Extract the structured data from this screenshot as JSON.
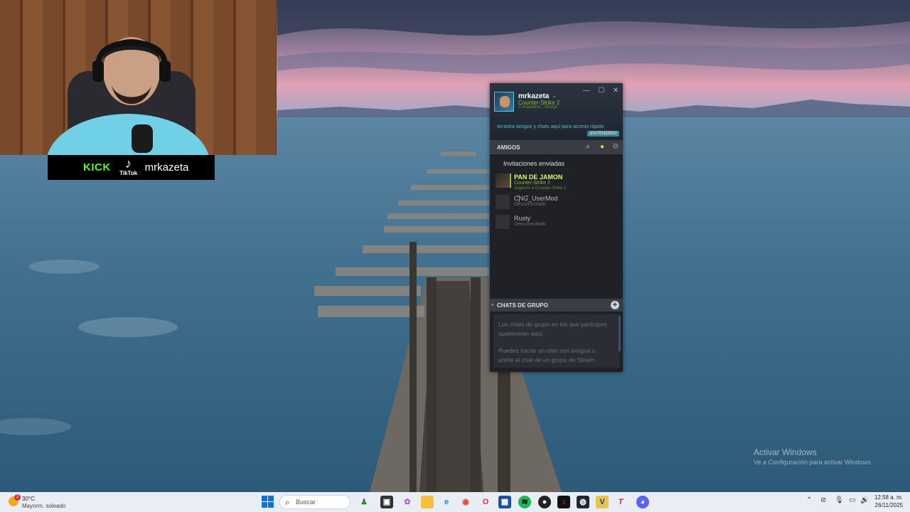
{
  "webcam": {
    "kick_label": "KICK",
    "tiktok_label": "TikTok",
    "channel_name": "mrkazeta"
  },
  "steam": {
    "user": {
      "name": "mrkazeta",
      "game": "Counter-Strike 2",
      "status": "Competitivo - Mirage"
    },
    "window_controls": {
      "minimize": "—",
      "maximize": "☐",
      "close": "✕"
    },
    "tip_text": "Arrastra amigos y chats aquí para acceso rápido",
    "got_it_label": "¡ENTENDIDO!",
    "friends_header": "AMIGOS",
    "sent_invites_label": "Invitaciones enviadas",
    "friends": [
      {
        "name": "PAN DE JAMON",
        "sub": "Counter-Strike 2",
        "sub2": "Jugando a Counter-Strike 2"
      },
      {
        "name": "ƇƝƓ_UserMod",
        "sub": "Desconectado"
      },
      {
        "name": "Rusty",
        "sub": "Desconectado"
      }
    ],
    "group_chats_header": "CHATS DE GRUPO",
    "group_chats_text1": "Los chats de grupo en los que participes aparecerán aquí.",
    "group_chats_text2": "Puedes iniciar un chat con amigos o unirte al chat de un grupo de Steam"
  },
  "activate_windows": {
    "title": "Activar Windows",
    "subtitle": "Ve a Configuración para activar Windows."
  },
  "taskbar": {
    "weather_temp": "30°C",
    "weather_desc": "Mayorm. soleado",
    "weather_badge": "2",
    "search_placeholder": "Buscar",
    "time": "12:58 a. m.",
    "date": "26/11/2025"
  },
  "colors": {
    "steam_bg": "#1f2126",
    "steam_ingame": "#90ba3c",
    "taskbar_bg": "#e9eef5",
    "kick_green": "#53fc18"
  }
}
